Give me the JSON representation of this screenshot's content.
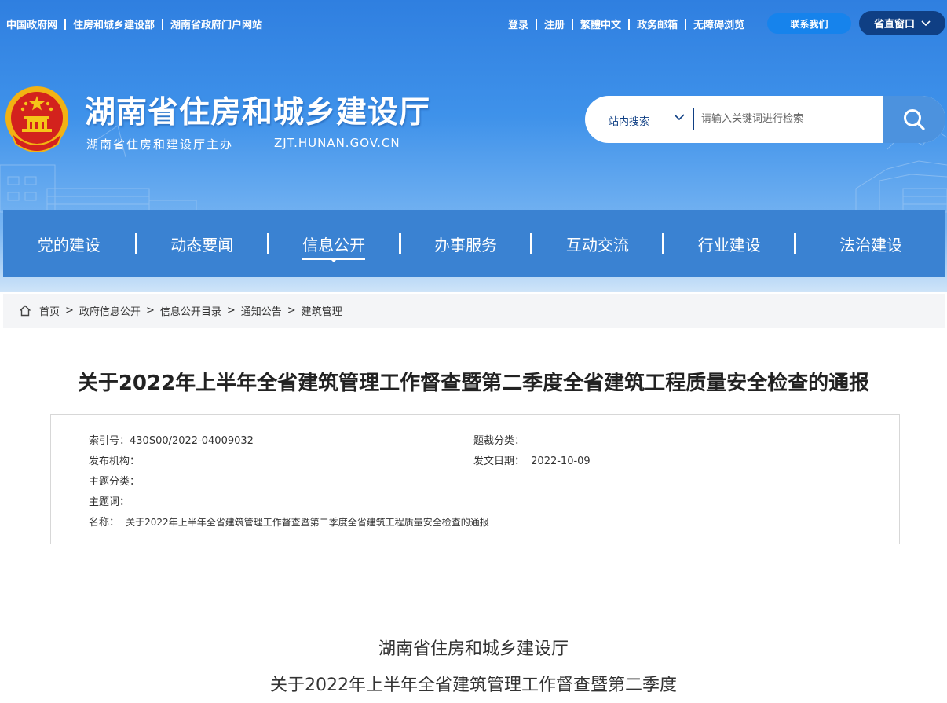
{
  "top_links_left": [
    "中国政府网",
    "住房和城乡建设部",
    "湖南省政府门户网站"
  ],
  "top_links_right": [
    "登录",
    "注册",
    "繁體中文",
    "政务邮箱",
    "无障碍浏览"
  ],
  "contact_button": "联系我们",
  "province_window": "省直窗口",
  "site": {
    "title": "湖南省住房和城乡建设厅",
    "subtitle": "湖南省住房和建设厅主办",
    "url": "ZJT.HUNAN.GOV.CN"
  },
  "search": {
    "scope": "站内搜索",
    "placeholder": "请输入关键词进行检索"
  },
  "nav": {
    "items": [
      {
        "label": "党的建设"
      },
      {
        "label": "动态要闻"
      },
      {
        "label": "信息公开",
        "active": true
      },
      {
        "label": "办事服务"
      },
      {
        "label": "互动交流"
      },
      {
        "label": "行业建设"
      },
      {
        "label": "法治建设"
      }
    ]
  },
  "breadcrumb": [
    "首页",
    "政府信息公开",
    "信息公开目录",
    "通知公告",
    "建筑管理"
  ],
  "article": {
    "title": "关于2022年上半年全省建筑管理工作督查暨第二季度全省建筑工程质量安全检查的通报",
    "meta": {
      "index_no": "索引号：430S00/2022-04009032",
      "category": "题裁分类：",
      "publisher": "发布机构：",
      "date_label": "发文日期：",
      "date_value": "2022-10-09",
      "topic": "主题分类：",
      "keywords": "主题词：",
      "name_label": "名称：",
      "name_value": "关于2022年上半年全省建筑管理工作督查暨第二季度全省建筑工程质量安全检查的通报"
    },
    "body_lines": [
      "湖南省住房和城乡建设厅",
      "关于2022年上半年全省建筑管理工作督查暨第二季度"
    ]
  },
  "colors": {
    "nav_bg": "#3a82d2",
    "contact_bg": "#1683ec",
    "province_bg": "#0f3f84",
    "search_button": "#4c92de"
  }
}
